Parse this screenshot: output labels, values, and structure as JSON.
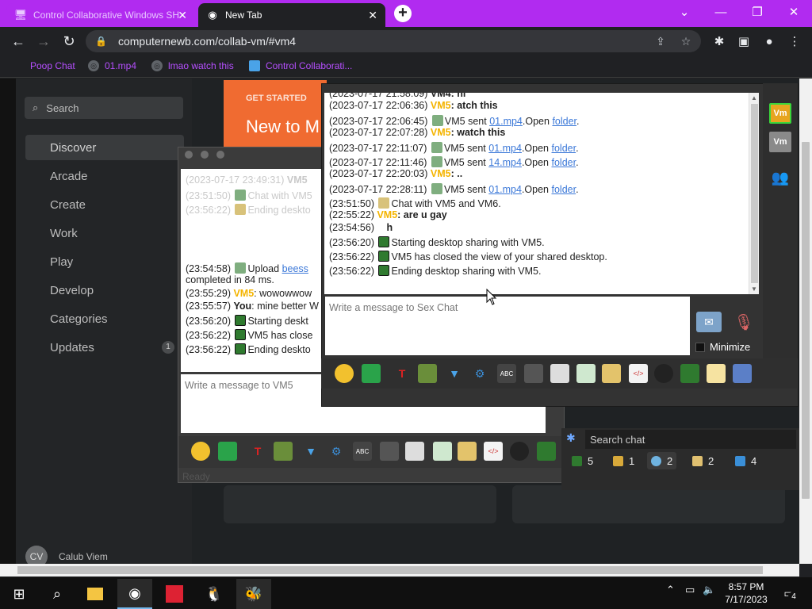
{
  "browser": {
    "tabs": [
      {
        "title": "Control Collaborative Windows SH"
      },
      {
        "title": "New Tab"
      }
    ],
    "url": "computernewb.com/collab-vm/#vm4",
    "bookmarks": [
      {
        "label": "Poop Chat"
      },
      {
        "label": "01.mp4"
      },
      {
        "label": "lmao watch this"
      },
      {
        "label": "Control Collaborati..."
      }
    ]
  },
  "sidebar": {
    "search_placeholder": "Search",
    "items": [
      {
        "label": "Discover"
      },
      {
        "label": "Arcade"
      },
      {
        "label": "Create"
      },
      {
        "label": "Work"
      },
      {
        "label": "Play"
      },
      {
        "label": "Develop"
      },
      {
        "label": "Categories"
      },
      {
        "label": "Updates",
        "badge": "1"
      }
    ],
    "user": {
      "initials": "CV",
      "name": "Calub Viem"
    }
  },
  "promo": {
    "eyebrow": "GET STARTED",
    "title": "New to M"
  },
  "vm6_window": {
    "lines": [
      {
        "time": "(2023-07-17 23:49:31)",
        "text": "VM5"
      },
      {
        "time": "(23:51:50)",
        "text": "Chat with VM5"
      },
      {
        "time": "(23:56:22)",
        "text": "Ending deskto"
      },
      {
        "time": "(23:54:58)",
        "text": "Upload",
        "link": "beess",
        "text2": ""
      },
      {
        "time": "",
        "text": "completed in 84 ms."
      },
      {
        "time": "(23:55:29)",
        "sender": "VM5",
        "text": ": wowowwow"
      },
      {
        "time": "(23:55:57)",
        "sender": "You",
        "text": ": mine better W"
      },
      {
        "time": "(23:56:20)",
        "text": "Starting deskt"
      },
      {
        "time": "(23:56:22)",
        "text": "VM5 has close"
      },
      {
        "time": "(23:56:22)",
        "text": "Ending deskto"
      }
    ],
    "input_placeholder": "Write a message to VM5",
    "status": "Ready"
  },
  "vm4_window": {
    "lines": [
      {
        "time": "(2023-07-17 21:58:09)",
        "sender": "VM4",
        "text": ": hi"
      },
      {
        "time": "(2023-07-17 22:06:36)",
        "sender": "VM5",
        "text": ": atch this"
      },
      {
        "time": "(2023-07-17 22:06:45)",
        "text": "VM5 sent",
        "link": "01.mp4",
        "text2": ".Open",
        "link2": "folder",
        "text3": "."
      },
      {
        "time": "(2023-07-17 22:07:28)",
        "sender": "VM5",
        "text": ": watch this"
      },
      {
        "time": "(2023-07-17 22:11:07)",
        "text": "VM5 sent",
        "link": "01.mp4",
        "text2": ".Open",
        "link2": "folder",
        "text3": "."
      },
      {
        "time": "(2023-07-17 22:11:46)",
        "text": "VM5 sent",
        "link": "14.mp4",
        "text2": ".Open",
        "link2": "folder",
        "text3": "."
      },
      {
        "time": "(2023-07-17 22:20:03)",
        "sender": "VM5",
        "text": ": .."
      },
      {
        "time": "(2023-07-17 22:28:11)",
        "text": "VM5 sent",
        "link": "01.mp4",
        "text2": ".Open",
        "link2": "folder",
        "text3": "."
      },
      {
        "time": "(23:51:50)",
        "text": "Chat with VM5 and VM6."
      },
      {
        "time": "(22:55:22)",
        "sender": "VM5",
        "text": ": are u gay"
      },
      {
        "time": "(23:54:56)",
        "text": "h"
      },
      {
        "time": "(23:56:20)",
        "text": "Starting desktop sharing with VM5."
      },
      {
        "time": "(23:56:22)",
        "text": "VM5 has closed the view of your shared desktop."
      },
      {
        "time": "(23:56:22)",
        "text": "Ending desktop sharing with VM5."
      }
    ],
    "input_placeholder": "Write a message to Sex Chat",
    "minimize_label": "Minimize",
    "vm_buttons": [
      {
        "label": "Vm"
      },
      {
        "label": "Vm"
      }
    ]
  },
  "chat_list": {
    "search_placeholder": "Search chat",
    "counters": [
      {
        "value": "5"
      },
      {
        "value": "1"
      },
      {
        "value": "2"
      },
      {
        "value": "2"
      },
      {
        "value": "4"
      }
    ]
  },
  "taskbar": {
    "time": "8:57 PM",
    "date": "7/17/2023",
    "notifications": "4"
  },
  "colors": {
    "tab_strip": "#b12bf0",
    "sender_highlight": "#f4b400",
    "link": "#3b78d8",
    "bookmark_text": "#b64fff"
  }
}
